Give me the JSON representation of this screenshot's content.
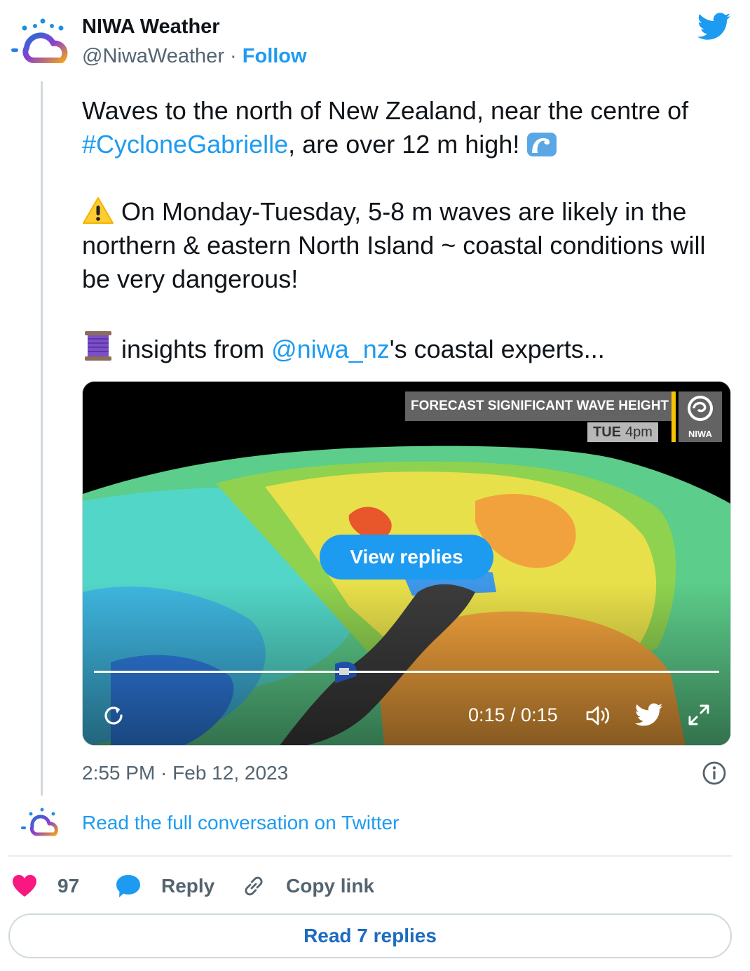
{
  "author": {
    "name": "NIWA Weather",
    "handle": "@NiwaWeather",
    "separator": " · ",
    "follow_label": "Follow"
  },
  "tweet": {
    "p1_a": "Waves to the north of New Zealand, near the centre of ",
    "p1_hashtag": "#CycloneGabrielle",
    "p1_b": ", are over 12 m high!",
    "p2": "On Monday-Tuesday, 5-8 m waves are likely in the northern & eastern North Island ~ coastal conditions will be very dangerous!",
    "p3_mention": "@niwa_nz",
    "p3_b": "'s coastal experts..."
  },
  "media": {
    "overlay_title": "FORECAST SIGNIFICANT WAVE HEIGHT",
    "overlay_day": "TUE",
    "overlay_time": "4pm",
    "overlay_logo_text": "NIWA",
    "view_replies_label": "View replies",
    "time_readout": "0:15 / 0:15",
    "progress": 1.0
  },
  "meta": {
    "timestamp": "2:55 PM · Feb 12, 2023",
    "read_conversation": "Read the full conversation on Twitter"
  },
  "actions": {
    "like_count": "97",
    "reply_label": "Reply",
    "copy_link_label": "Copy link"
  },
  "footer": {
    "read_replies_label": "Read 7 replies"
  },
  "colors": {
    "accent": "#1d9bf0",
    "heart": "#f91880",
    "text_secondary": "#536471"
  },
  "icons": [
    "niwa-logo-icon",
    "twitter-bird-icon",
    "wave-emoji-icon",
    "warning-emoji-icon",
    "thread-emoji-icon",
    "replay-icon",
    "volume-icon",
    "fullscreen-icon",
    "info-icon",
    "heart-icon",
    "reply-bubble-icon",
    "link-icon"
  ]
}
